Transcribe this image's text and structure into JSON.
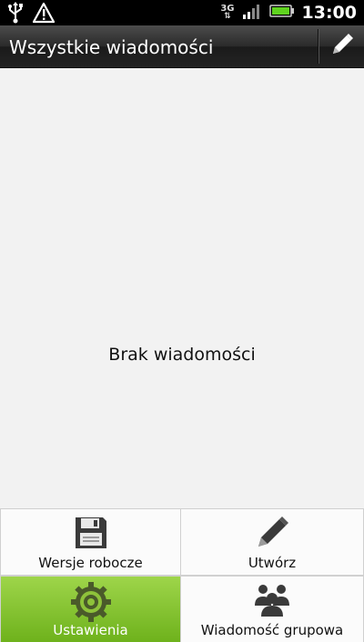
{
  "status_bar": {
    "time": "13:00",
    "network_label": "3G",
    "icons": [
      "usb-icon",
      "warning-icon",
      "signal-icon",
      "battery-icon"
    ]
  },
  "title_bar": {
    "title": "Wszystkie wiadomości",
    "compose_icon": "pencil-icon"
  },
  "content": {
    "empty_text": "Brak wiadomości"
  },
  "menu": {
    "items": [
      {
        "label": "Wersje robocze",
        "icon": "floppy-disk-icon"
      },
      {
        "label": "Utwórz",
        "icon": "pencil-icon"
      },
      {
        "label": "Ustawienia",
        "icon": "gear-icon",
        "highlighted": true
      },
      {
        "label": "Wiadomość grupowa",
        "icon": "group-icon"
      }
    ]
  },
  "colors": {
    "highlight_green": "#8cc63f",
    "content_bg": "#f2f2f2",
    "battery_green": "#5fd31f"
  }
}
